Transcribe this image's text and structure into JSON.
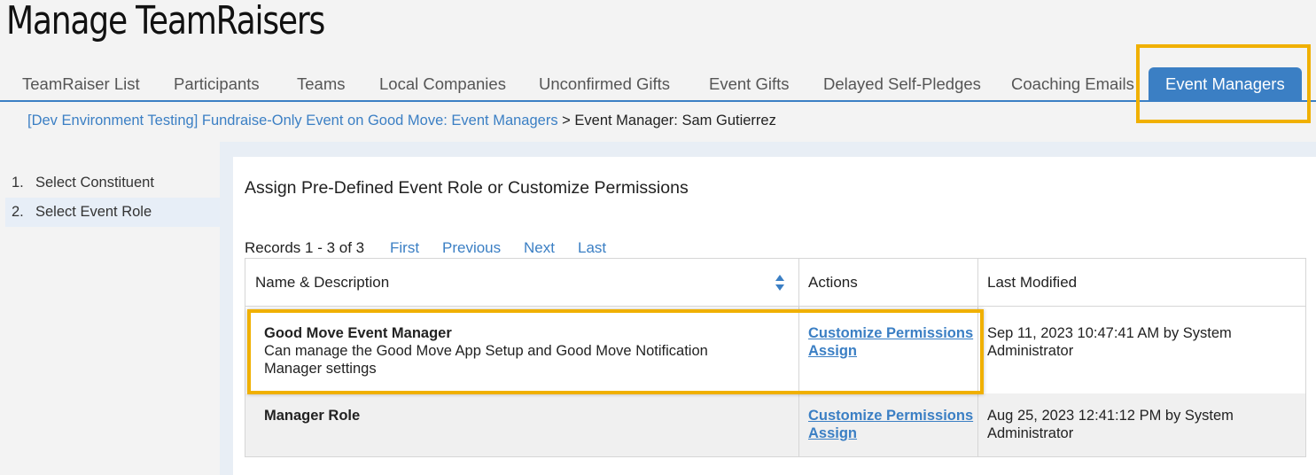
{
  "page": {
    "title": "Manage TeamRaisers"
  },
  "tabs": [
    {
      "label": "TeamRaiser List"
    },
    {
      "label": "Participants"
    },
    {
      "label": "Teams"
    },
    {
      "label": "Local Companies"
    },
    {
      "label": "Unconfirmed Gifts"
    },
    {
      "label": "Event Gifts"
    },
    {
      "label": "Delayed Self-Pledges"
    },
    {
      "label": "Coaching Emails"
    },
    {
      "label": "Event Managers",
      "active": true
    }
  ],
  "breadcrumb": {
    "link": "[Dev Environment Testing] Fundraise-Only Event on Good Move: Event Managers",
    "separator": ">",
    "current": "Event Manager: Sam Gutierrez"
  },
  "steps": [
    {
      "num": "1.",
      "label": "Select Constituent"
    },
    {
      "num": "2.",
      "label": "Select Event Role",
      "current": true
    }
  ],
  "main": {
    "title": "Assign Pre-Defined Event Role or Customize Permissions",
    "pager": {
      "records": "Records 1 - 3 of 3",
      "first": "First",
      "previous": "Previous",
      "next": "Next",
      "last": "Last"
    },
    "table": {
      "headers": {
        "name": "Name & Description",
        "actions": "Actions",
        "modified": "Last Modified"
      },
      "rows": [
        {
          "name": "Good Move Event Manager",
          "description": "Can manage the Good Move App Setup and Good Move Notification Manager settings",
          "action_customize": "Customize Permissions",
          "action_assign": "Assign",
          "modified": "Sep 11, 2023 10:47:41 AM by System Administrator"
        },
        {
          "name": "Manager Role",
          "description": "",
          "action_customize": "Customize Permissions",
          "action_assign": "Assign",
          "modified": "Aug 25, 2023 12:41:12 PM by System Administrator"
        }
      ]
    }
  },
  "colors": {
    "accent": "#3b7fc4",
    "highlight": "#f0b000",
    "background": "#f3f3f3"
  }
}
